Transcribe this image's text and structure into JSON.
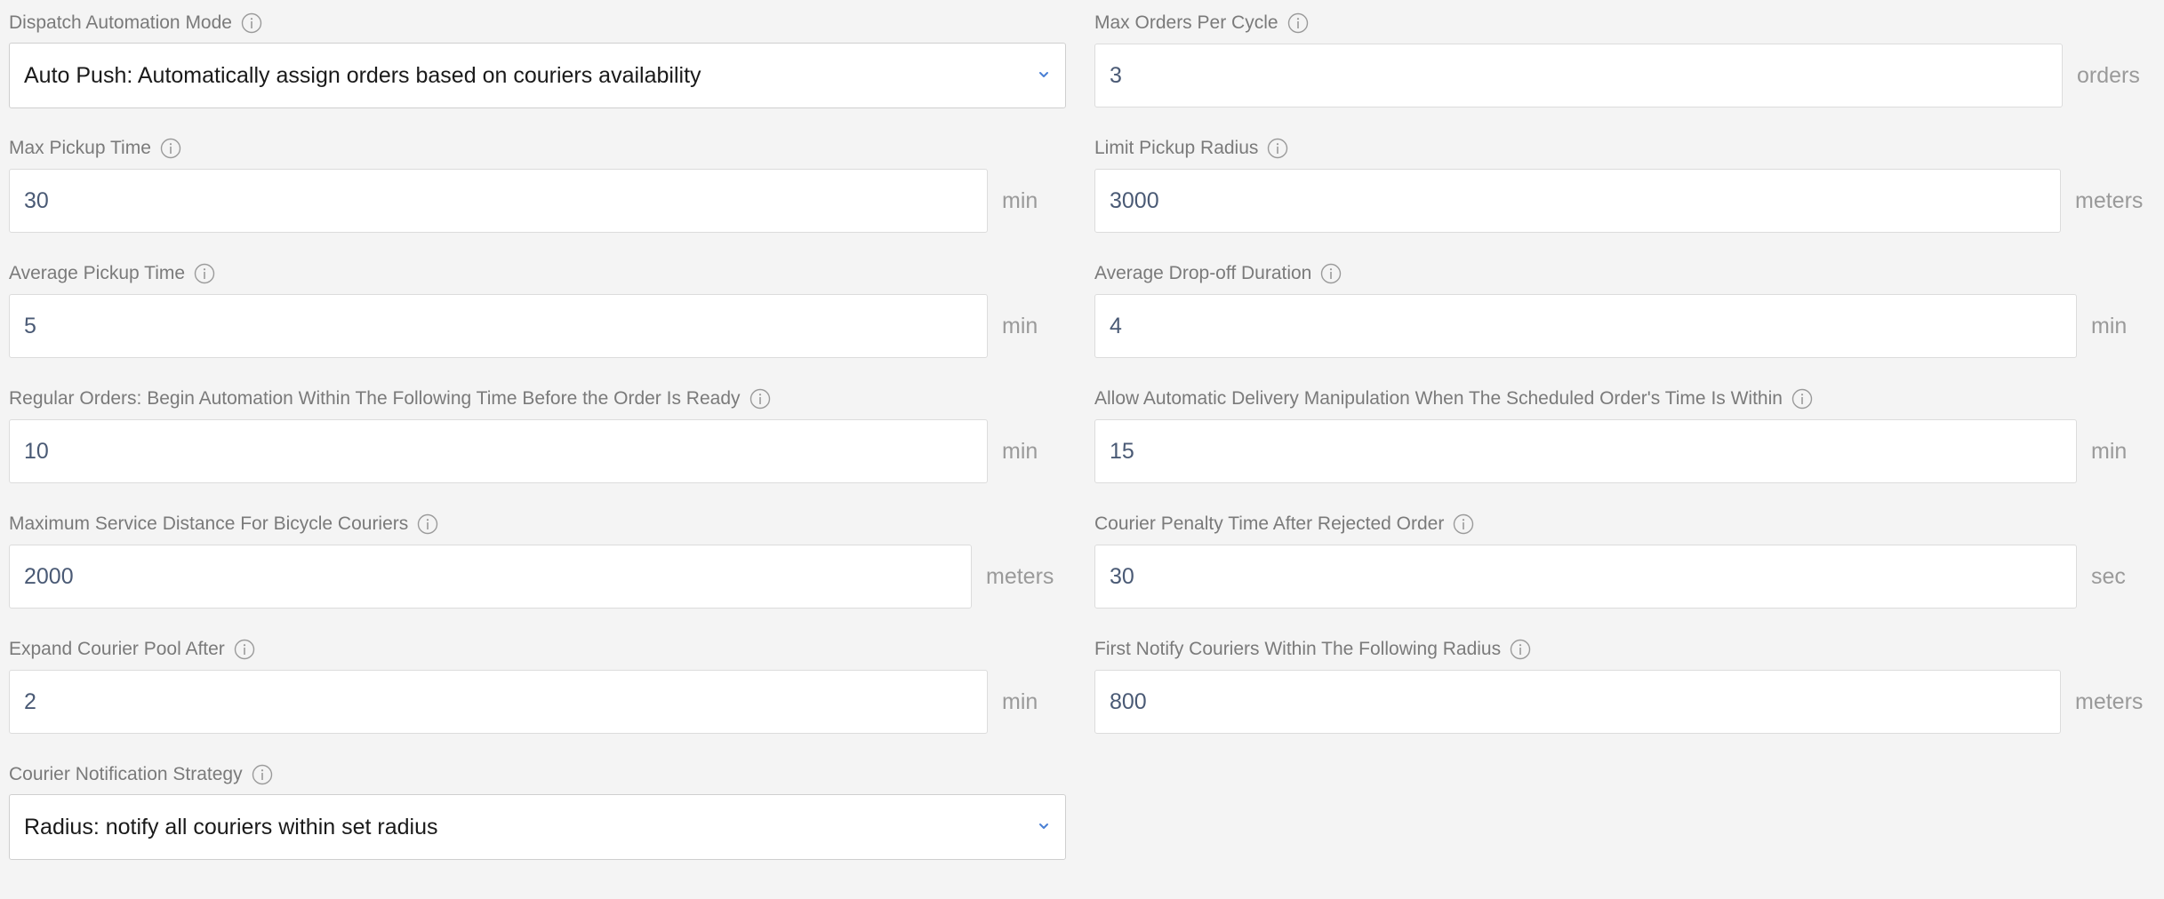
{
  "fields": {
    "dispatch_mode": {
      "label": "Dispatch Automation Mode",
      "value": "Auto Push: Automatically assign orders based on couriers availability"
    },
    "max_orders_per_cycle": {
      "label": "Max Orders Per Cycle",
      "value": "3",
      "unit": "orders"
    },
    "max_pickup_time": {
      "label": "Max Pickup Time",
      "value": "30",
      "unit": "min"
    },
    "limit_pickup_radius": {
      "label": "Limit Pickup Radius",
      "value": "3000",
      "unit": "meters"
    },
    "average_pickup_time": {
      "label": "Average Pickup Time",
      "value": "5",
      "unit": "min"
    },
    "average_dropoff_duration": {
      "label": "Average Drop-off Duration",
      "value": "4",
      "unit": "min"
    },
    "regular_orders_begin": {
      "label": "Regular Orders: Begin Automation Within The Following Time Before the Order Is Ready",
      "value": "10",
      "unit": "min"
    },
    "allow_auto_delivery": {
      "label": "Allow Automatic Delivery Manipulation When The Scheduled Order's Time Is Within",
      "value": "15",
      "unit": "min"
    },
    "max_bicycle_distance": {
      "label": "Maximum Service Distance For Bicycle Couriers",
      "value": "2000",
      "unit": "meters"
    },
    "courier_penalty_time": {
      "label": "Courier Penalty Time After Rejected Order",
      "value": "30",
      "unit": "sec"
    },
    "expand_courier_pool": {
      "label": "Expand Courier Pool After",
      "value": "2",
      "unit": "min"
    },
    "first_notify_radius": {
      "label": "First Notify Couriers Within The Following Radius",
      "value": "800",
      "unit": "meters"
    },
    "notification_strategy": {
      "label": "Courier Notification Strategy",
      "value": "Radius: notify all couriers within set radius"
    }
  },
  "icons": {
    "info": "info-circle-icon",
    "dropdown": "chevron-down-icon"
  },
  "colors": {
    "background": "#f4f4f4",
    "label": "#7a7a7a",
    "value": "#4a5a75",
    "unit": "#9a9a9a",
    "accent": "#4a7fd4",
    "border": "#dcdcdc"
  }
}
